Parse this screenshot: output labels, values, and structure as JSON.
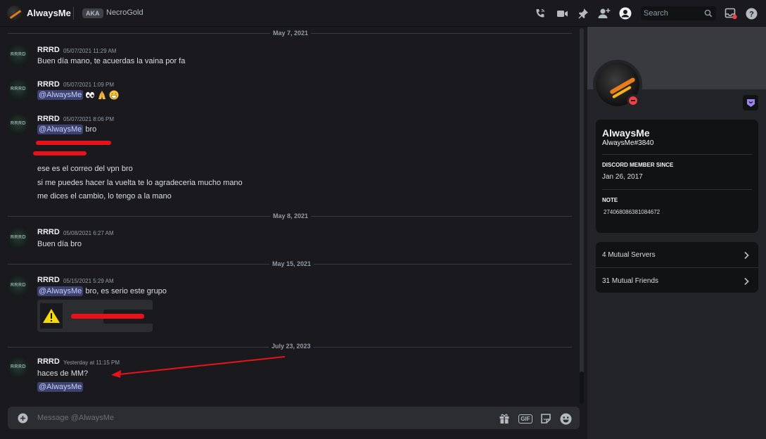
{
  "header": {
    "name": "AlwaysMe",
    "aka_label": "AKA",
    "aka_name": "NecroGold",
    "search_placeholder": "Search",
    "icons": [
      "phone-call-icon",
      "video-call-icon",
      "pin-icon",
      "add-friend-icon",
      "user-profile-icon",
      "search-icon",
      "inbox-icon",
      "help-icon"
    ]
  },
  "dividers": [
    "May 7, 2021",
    "May 8, 2021",
    "May 15, 2021",
    "July 23, 2023"
  ],
  "avatar_initials": "RRRD",
  "messages": [
    {
      "author": "RRRD",
      "time": "05/07/2021 11:29 AM",
      "lines": [
        "Buen día mano, te acuerdas la vaina por fa"
      ]
    },
    {
      "author": "RRRD",
      "time": "05/07/2021 1:09 PM",
      "mention": "@AlwaysMe",
      "emojis": [
        "eyes-emoji",
        "pray-emoji",
        "grin-emoji"
      ]
    },
    {
      "author": "RRRD",
      "time": "05/07/2021 8:06 PM",
      "mention": "@AlwaysMe",
      "mention_suffix": " bro",
      "lines": [
        "ese es el correo del vpn bro",
        "si me puedes hacer la vuelta te lo agradeceria mucho mano",
        "me dices el cambio, lo tengo a la mano"
      ]
    },
    {
      "author": "RRRD",
      "time": "05/08/2021 6:27 AM",
      "lines": [
        "Buen día bro"
      ]
    },
    {
      "author": "RRRD",
      "time": "05/15/2021 5:29 AM",
      "mention": "@AlwaysMe",
      "mention_suffix": " bro, es serio este grupo"
    },
    {
      "author": "RRRD",
      "time": "Yesterday at 11:15 PM",
      "lines": [
        "haces de MM?"
      ],
      "mention": "@AlwaysMe"
    }
  ],
  "composer": {
    "placeholder": "Message @AlwaysMe",
    "gif_label": "GIF",
    "icons": [
      "add-attachment-icon",
      "gift-icon",
      "gif-icon",
      "sticker-icon",
      "emoji-icon"
    ]
  },
  "profile": {
    "display_name": "AlwaysMe",
    "tag": "AlwaysMe#3840",
    "member_since_heading": "DISCORD MEMBER SINCE",
    "member_since": "Jan 26, 2017",
    "note_heading": "NOTE",
    "note": "274068086381084672",
    "mutual_servers": "4 Mutual Servers",
    "mutual_friends": "31 Mutual Friends",
    "status": "do-not-disturb"
  },
  "colors": {
    "background": "#1a1a1e",
    "mention_bg": "#3c4270",
    "redaction": "#e8121a",
    "dnd": "#f23f43"
  }
}
